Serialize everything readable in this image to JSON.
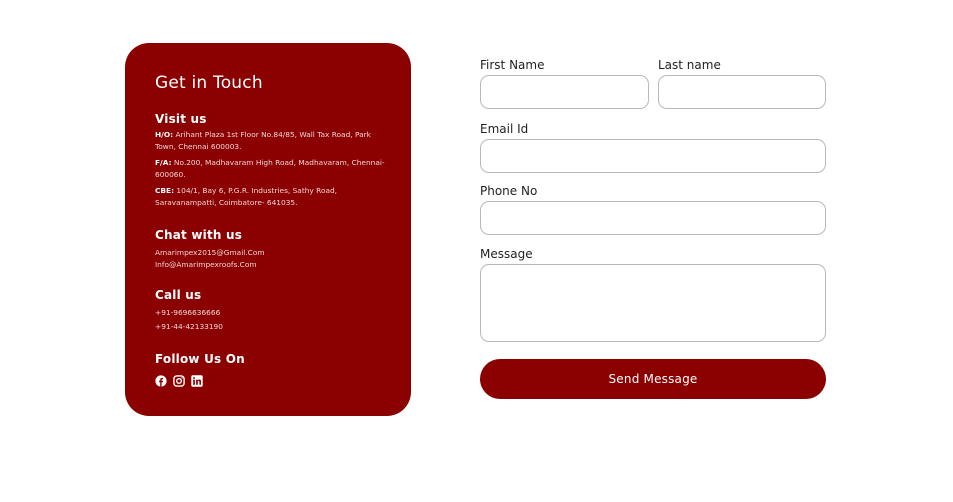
{
  "contact_card": {
    "title": "Get in Touch",
    "visit": {
      "heading": "Visit us",
      "addresses": [
        {
          "tag": "H/O:",
          "text": "Arihant Plaza 1st Floor No.84/85, Wall Tax Road, Park Town, Chennai 600003."
        },
        {
          "tag": "F/A:",
          "text": "No.200, Madhavaram High Road, Madhavaram, Chennai-600060."
        },
        {
          "tag": "CBE:",
          "text": "104/1, Bay 6, P.G.R. Industries, Sathy Road, Saravanampatti, Coimbatore- 641035."
        }
      ]
    },
    "chat": {
      "heading": "Chat with us",
      "emails": [
        "Amarimpex2015@Gmail.Com",
        "Info@Amarimpexroofs.Com"
      ]
    },
    "call": {
      "heading": "Call us",
      "phones": [
        "+91-9696636666",
        "+91-44-42133190"
      ]
    },
    "follow": {
      "heading": "Follow Us On",
      "icons": [
        "facebook-icon",
        "instagram-icon",
        "linkedin-icon"
      ]
    },
    "colors": {
      "background": "#8b0000",
      "text": "#ffffff"
    }
  },
  "form": {
    "first_name_label": "First Name",
    "last_name_label": "Last name",
    "email_label": "Email Id",
    "phone_label": "Phone No",
    "message_label": "Message",
    "first_name_value": "",
    "last_name_value": "",
    "email_value": "",
    "phone_value": "",
    "message_value": "",
    "submit_label": "Send Message"
  }
}
